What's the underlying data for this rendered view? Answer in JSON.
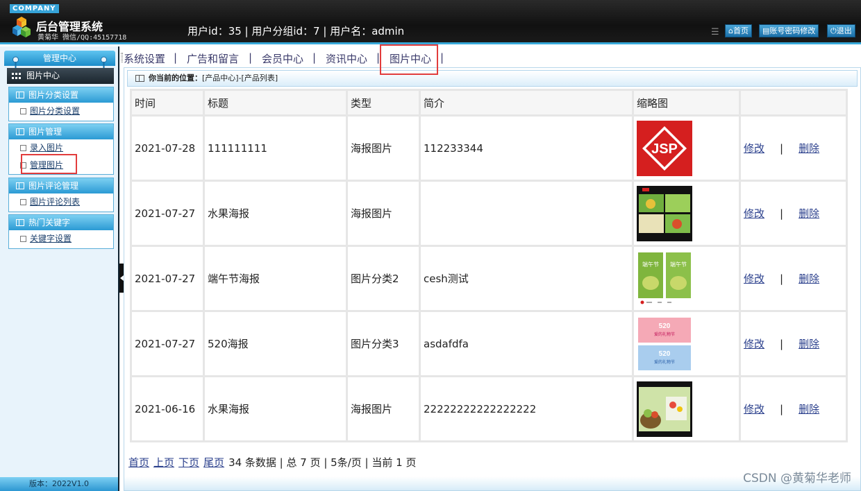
{
  "header": {
    "company": "COMPANY",
    "title": "后台管理系统",
    "author": "黄菊华 微信/QQ:45157718",
    "user_info": "用户id：35 | 用户分组id：7 | 用户名：admin",
    "buttons": {
      "home": "首页",
      "password": "账号密码修改",
      "logout": "退出"
    }
  },
  "sidebar": {
    "top_title": "管理中心",
    "current": "图片中心",
    "groups": [
      {
        "title": "图片分类设置",
        "items": [
          "图片分类设置"
        ]
      },
      {
        "title": "图片管理",
        "items": [
          "录入图片",
          "管理图片"
        ]
      },
      {
        "title": "图片评论管理",
        "items": [
          "图片评论列表"
        ]
      },
      {
        "title": "热门关键字",
        "items": [
          "关键字设置"
        ]
      }
    ],
    "version": "版本：2022V1.0"
  },
  "topnav": {
    "items": [
      "系统设置",
      "广告和留言",
      "会员中心",
      "资讯中心",
      "图片中心"
    ],
    "active": "图片中心"
  },
  "breadcrumb": {
    "label": "你当前的位置：",
    "path": "[产品中心]-[产品列表]"
  },
  "table": {
    "columns": [
      "时间",
      "标题",
      "类型",
      "简介",
      "缩略图",
      ""
    ],
    "edit_label": "修改",
    "delete_label": "删除",
    "rows": [
      {
        "date": "2021-07-28",
        "title": "111111111",
        "type": "海报图片",
        "intro": "112233344",
        "thumb": "jsp-logo"
      },
      {
        "date": "2021-07-27",
        "title": "水果海报",
        "type": "海报图片",
        "intro": "",
        "thumb": "fruit-poster"
      },
      {
        "date": "2021-07-27",
        "title": "端午节海报",
        "type": "图片分类2",
        "intro": "cesh测试",
        "thumb": "duanwu-poster"
      },
      {
        "date": "2021-07-27",
        "title": "520海报",
        "type": "图片分类3",
        "intro": "asdafdfa",
        "thumb": "520-poster"
      },
      {
        "date": "2021-06-16",
        "title": "水果海报",
        "type": "海报图片",
        "intro": "22222222222222222",
        "thumb": "fruit-poster-2"
      }
    ],
    "thumb_texts": {
      "jsp": "JSP",
      "duanwu": "端午节",
      "p520": "520",
      "p520_sub": "爱的礼物节"
    }
  },
  "pager": {
    "first": "首页",
    "prev": "上页",
    "next": "下页",
    "last": "尾页",
    "summary": "34 条数据 | 总 7 页 | 5条/页 | 当前 1 页"
  },
  "watermark": "CSDN @黄菊华老师",
  "colors": {
    "accent": "#2b9ad4",
    "highlight": "#e23c3c",
    "link": "#2a3f8c"
  }
}
